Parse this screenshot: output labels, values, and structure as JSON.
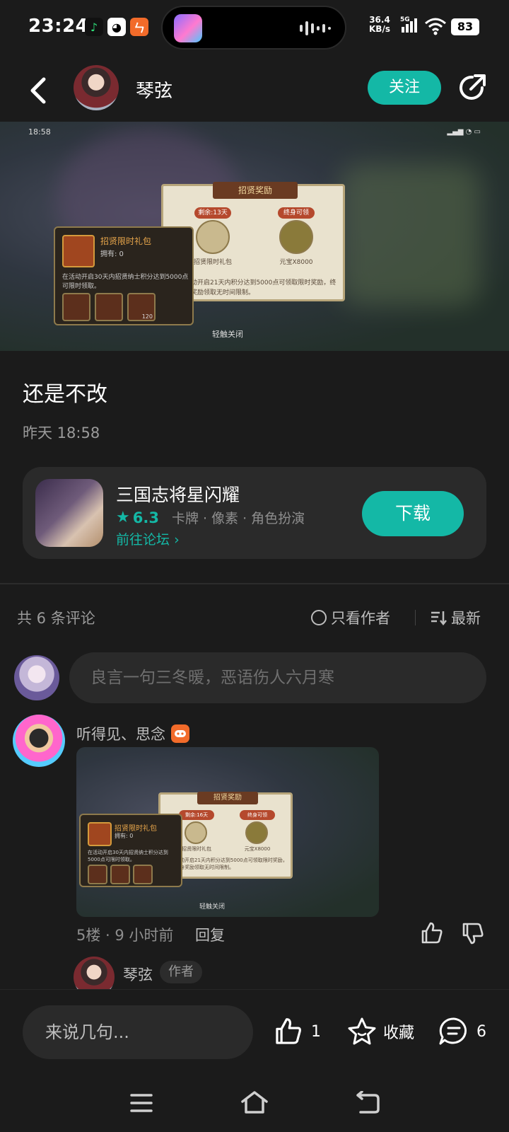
{
  "status_bar": {
    "time": "23:24",
    "net_speed": "36.4",
    "net_unit": "KB/s",
    "network": "5G",
    "battery": "83"
  },
  "header": {
    "author_name": "琴弦",
    "follow_label": "关注"
  },
  "post": {
    "screenshot": {
      "time": "18:58",
      "panel_title": "招贤奖励",
      "remaining": "剩余:13天",
      "claimable": "终身可领",
      "item_1": "招贤限时礼包",
      "item_2": "元宝X8000",
      "note": "活动开启21天内积分达到5000点可领取限时奖励，终身奖励领取无时间限制。",
      "gift_title": "招贤限时礼包",
      "gift_owned": "拥有: 0",
      "gift_desc": "在活动开启30天内招贤纳士积分达到5000点可限时领取。",
      "gift_count": "120",
      "tap_close": "轻触关闭"
    },
    "title": "还是不改",
    "time": "昨天 18:58"
  },
  "game_card": {
    "name": "三国志将星闪耀",
    "rating": "6.3",
    "tags": "卡牌 · 像素 · 角色扮演",
    "forum_link": "前往论坛",
    "download_label": "下载"
  },
  "comments": {
    "count_label": "共 6 条评论",
    "only_author_label": "只看作者",
    "sort_label": "最新",
    "input_placeholder": "良言一句三冬暖，恶语伤人六月寒",
    "items": [
      {
        "user": "听得见、思念",
        "image": {
          "panel_title": "招贤奖励",
          "remaining": "剩余:16天",
          "claimable": "终身可领",
          "item_1": "招贤限时礼包",
          "item_2": "元宝X8000",
          "note": "活动开启21天内积分达到5000点可领取限时奖励，终身奖励领取无时间限制。",
          "gift_title": "招贤限时礼包",
          "gift_owned": "拥有: 0",
          "gift_desc": "在活动开启30天内招贤纳士积分达到5000点可限时领取。",
          "tap_close": "轻触关闭"
        },
        "meta": "5楼 · 9 小时前",
        "reply_label": "回复",
        "sub_reply": {
          "user": "琴弦",
          "badge": "作者"
        }
      }
    ]
  },
  "bottom_bar": {
    "input_placeholder": "来说几句...",
    "like_count": "1",
    "favorite_label": "收藏",
    "comment_count": "6"
  },
  "colors": {
    "accent": "#14b8a6",
    "background": "#1b1b1b",
    "card": "#2a2a2a"
  }
}
